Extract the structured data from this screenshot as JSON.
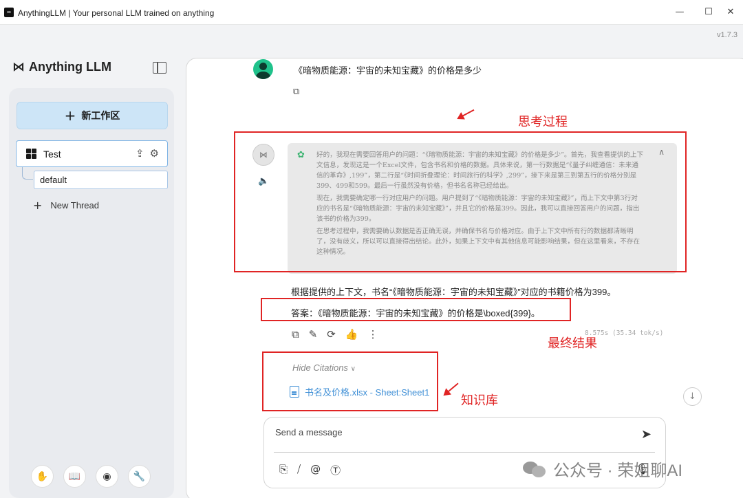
{
  "window": {
    "title": "AnythingLLM | Your personal LLM trained on anything",
    "minimize": "—",
    "maximize": "☐",
    "close": "✕",
    "version": "v1.7.3"
  },
  "sidebar": {
    "brand": "Anything LLM",
    "new_workspace": "新工作区",
    "workspace": {
      "name": "Test"
    },
    "threads": [
      {
        "label": "default"
      }
    ],
    "new_thread": "New Thread"
  },
  "chat": {
    "user_message": "《暗物质能源：宇宙的未知宝藏》的价格是多少",
    "thinking": [
      "好的，我现在需要回答用户的问题：“《暗物质能源：宇宙的未知宝藏》的价格是多少”。首先，我查看提供的上下文信息，发现这是一个Excel文件，包含书名和价格的数据。具体来说，第一行数据是“《量子纠缠通信：未来通信的革命》,199”，第二行是“《时间折叠理论：时间旅行的科学》,299”，接下来是第三到第五行的价格分别是399、499和599。最后一行虽然没有价格，但书名名称已经给出。",
      "现在，我需要确定哪一行对应用户的问题。用户提到了“《暗物质能源：宇宙的未知宝藏》”，而上下文中第3行对应的书名是“《暗物质能源：宇宙的未知宝藏》”，并且它的价格是399。因此，我可以直接回答用户的问题，指出该书的价格为399。",
      "在思考过程中，我需要确认数据是否正确无误，并确保书名与价格对应。由于上下文中所有行的数据都清晰明了，没有歧义，所以可以直接得出结论。此外，如果上下文中有其他信息可能影响结果，但在这里看来，不存在这种情况。"
    ],
    "answer_line1": "根据提供的上下文，书名“《暗物质能源：宇宙的未知宝藏》”对应的书籍价格为399。",
    "answer_line2": "答案：《暗物质能源：宇宙的未知宝藏》的价格是\\boxed{399}。",
    "stats": "8.575s (35.34 tok/s)",
    "hide_citations": "Hide Citations",
    "citation": "书名及价格.xlsx - Sheet:Sheet1"
  },
  "composer": {
    "placeholder": "Send a message"
  },
  "annotations": {
    "thinking_label": "思考过程",
    "result_label": "最终结果",
    "kb_label": "知识库",
    "color": "#e02424"
  },
  "watermark": {
    "text": "公众号 · 荣姐聊AI"
  },
  "colors": {
    "accent": "#cde5f7",
    "citation": "#3f8fd6",
    "avatar": "#1fc28b"
  }
}
